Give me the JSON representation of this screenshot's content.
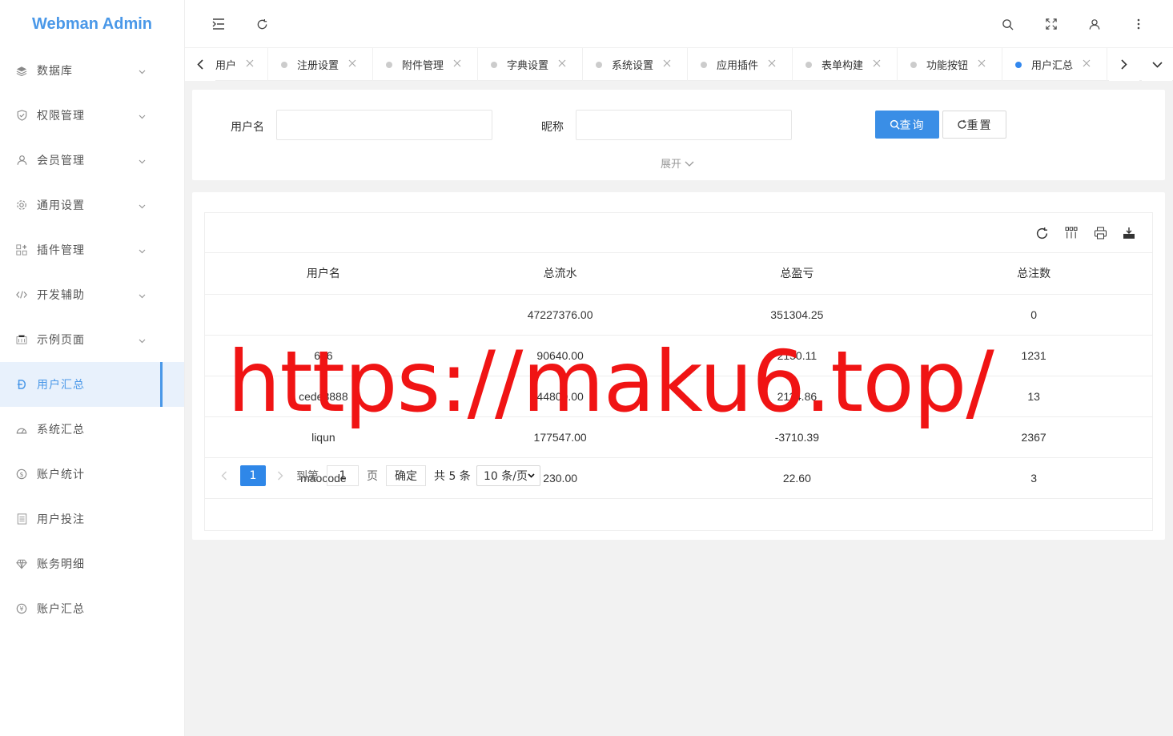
{
  "app": {
    "title": "Webman Admin"
  },
  "sidebar": {
    "items": [
      {
        "label": "数据库",
        "icon": "layers-icon",
        "arrow": true
      },
      {
        "label": "权限管理",
        "icon": "shield-icon",
        "arrow": true
      },
      {
        "label": "会员管理",
        "icon": "user-icon",
        "arrow": true
      },
      {
        "label": "通用设置",
        "icon": "gear-icon",
        "arrow": true
      },
      {
        "label": "插件管理",
        "icon": "apps-icon",
        "arrow": true
      },
      {
        "label": "开发辅助",
        "icon": "code-icon",
        "arrow": true
      },
      {
        "label": "示例页面",
        "icon": "template-icon",
        "arrow": true
      },
      {
        "label": "用户汇总",
        "icon": "dollar-icon",
        "arrow": false,
        "active": true
      },
      {
        "label": "系统汇总",
        "icon": "dashboard-icon",
        "arrow": false
      },
      {
        "label": "账户统计",
        "icon": "coin-icon",
        "arrow": false
      },
      {
        "label": "用户投注",
        "icon": "list-icon",
        "arrow": false
      },
      {
        "label": "账务明细",
        "icon": "diamond-icon",
        "arrow": false
      },
      {
        "label": "账户汇总",
        "icon": "yen-icon",
        "arrow": false
      }
    ]
  },
  "tabs": [
    {
      "label": "用户",
      "active": false,
      "partial": true
    },
    {
      "label": "注册设置",
      "active": false
    },
    {
      "label": "附件管理",
      "active": false
    },
    {
      "label": "字典设置",
      "active": false
    },
    {
      "label": "系统设置",
      "active": false
    },
    {
      "label": "应用插件",
      "active": false
    },
    {
      "label": "表单构建",
      "active": false
    },
    {
      "label": "功能按钮",
      "active": false
    },
    {
      "label": "用户汇总",
      "active": true
    }
  ],
  "search": {
    "username_label": "用户名",
    "username_value": "",
    "nickname_label": "昵称",
    "nickname_value": "",
    "query_label": "查询",
    "reset_label": "重置",
    "expand_label": "展开"
  },
  "table": {
    "columns": [
      "用户名",
      "总流水",
      "总盈亏",
      "总注数"
    ],
    "rows": [
      [
        "",
        "47227376.00",
        "351304.25",
        "0"
      ],
      [
        "666",
        "90640.00",
        "2150.11",
        "1231"
      ],
      [
        "cede8888",
        "44800.00",
        "2114.86",
        "13"
      ],
      [
        "liqun",
        "177547.00",
        "-3710.39",
        "2367"
      ],
      [
        "maocode",
        "230.00",
        "22.60",
        "3"
      ]
    ]
  },
  "pagination": {
    "current_page": "1",
    "goto_prefix": "到第",
    "goto_value": "1",
    "goto_suffix": "页",
    "confirm_label": "确定",
    "total_label": "共 5 条",
    "page_size_label": "10 条/页"
  },
  "watermark": "https://maku6.top/",
  "colors": {
    "accent": "#3a8ee6",
    "logo": "#4a98e8",
    "watermark": "#f01414"
  }
}
